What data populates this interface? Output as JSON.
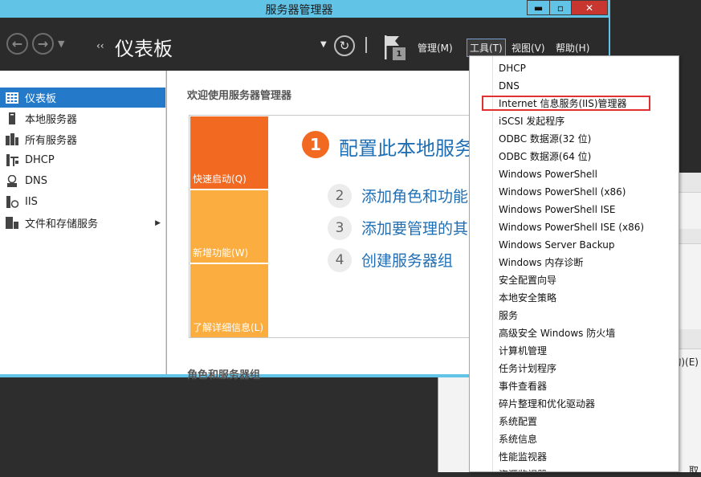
{
  "window": {
    "title": "服务器管理器",
    "min_symbol": "▬",
    "max_symbol": "▫",
    "close_symbol": "✕"
  },
  "nav": {
    "page_title": "仪表板",
    "crumb_arrow": "‹‹",
    "flag_badge": "1",
    "menus": {
      "manage": "管理(M)",
      "tools": "工具(T)",
      "view": "视图(V)",
      "help": "帮助(H)"
    }
  },
  "sidebar": {
    "items": [
      {
        "label": "仪表板",
        "icon": "dashboard-icon",
        "selected": true
      },
      {
        "label": "本地服务器",
        "icon": "local-server-icon"
      },
      {
        "label": "所有服务器",
        "icon": "all-servers-icon"
      },
      {
        "label": "DHCP",
        "icon": "dhcp-icon"
      },
      {
        "label": "DNS",
        "icon": "dns-icon"
      },
      {
        "label": "IIS",
        "icon": "iis-icon"
      },
      {
        "label": "文件和存储服务",
        "icon": "file-storage-icon",
        "has_children": true
      }
    ]
  },
  "content": {
    "welcome_heading": "欢迎使用服务器管理器",
    "tiles": {
      "quickstart": "快速启动(Q)",
      "newfeatures": "新增功能(W)",
      "learnmore": "了解详细信息(L)"
    },
    "steps": [
      {
        "num": "1",
        "label": "配置此本地服务"
      },
      {
        "num": "2",
        "label": "添加角色和功能"
      },
      {
        "num": "3",
        "label": "添加要管理的其"
      },
      {
        "num": "4",
        "label": "创建服务器组"
      }
    ],
    "roles_heading": "角色和服务器组"
  },
  "tools_menu": {
    "highlighted_index": 2,
    "items": [
      "DHCP",
      "DNS",
      "Internet 信息服务(IIS)管理器",
      "iSCSI 发起程序",
      "ODBC 数据源(32 位)",
      "ODBC 数据源(64 位)",
      "Windows PowerShell",
      "Windows PowerShell (x86)",
      "Windows PowerShell ISE",
      "Windows PowerShell ISE (x86)",
      "Windows Server Backup",
      "Windows 内存诊断",
      "安全配置向导",
      "本地安全策略",
      "服务",
      "高级安全 Windows 防火墙",
      "计算机管理",
      "任务计划程序",
      "事件查看器",
      "碎片整理和优化驱动器",
      "系统配置",
      "系统信息",
      "性能监视器",
      "资源监视器"
    ]
  },
  "background_window": {
    "fragment_e": "的)(E)",
    "fragment_bottom": "取"
  },
  "colors": {
    "titlebar": "#61c4e7",
    "navbar": "#2b2b2b",
    "selected": "#2479c9",
    "tile_primary": "#f26a22",
    "tile_secondary": "#fbae3f",
    "link": "#1f6fb5",
    "highlight_border": "#e0302f"
  }
}
